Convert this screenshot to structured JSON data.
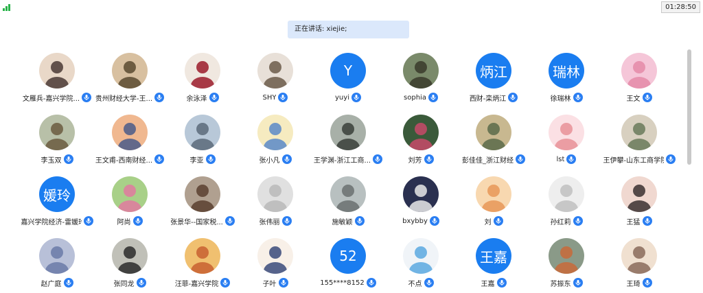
{
  "status": {
    "timer": "01:28:50"
  },
  "speaking": {
    "text": "正在讲话: xiejie;"
  },
  "colors": {
    "accent": "#1a7df0",
    "mic": "#2a7ef2",
    "banner_bg": "#dbe8fb",
    "signal": "#29b34a"
  },
  "participants": [
    {
      "name": "文雁兵-嘉兴学院...",
      "avatar_text": ""
    },
    {
      "name": "贵州财经大学-王...",
      "avatar_text": ""
    },
    {
      "name": "余泳泽",
      "avatar_text": ""
    },
    {
      "name": "SHY",
      "avatar_text": ""
    },
    {
      "name": "yuyi",
      "avatar_text": "Y"
    },
    {
      "name": "sophia",
      "avatar_text": ""
    },
    {
      "name": "西财-栾炳江",
      "avatar_text": "炳江"
    },
    {
      "name": "徐瑞林",
      "avatar_text": "瑞林"
    },
    {
      "name": "王文",
      "avatar_text": ""
    },
    {
      "name": "李玉双",
      "avatar_text": ""
    },
    {
      "name": "王文甫-西南财经...",
      "avatar_text": ""
    },
    {
      "name": "李亚",
      "avatar_text": ""
    },
    {
      "name": "张小凡",
      "avatar_text": ""
    },
    {
      "name": "王学渊-浙江工商...",
      "avatar_text": ""
    },
    {
      "name": "刘芳",
      "avatar_text": ""
    },
    {
      "name": "彭佳佳_浙江财经",
      "avatar_text": ""
    },
    {
      "name": "lst",
      "avatar_text": ""
    },
    {
      "name": "王伊攀-山东工商学院",
      "avatar_text": ""
    },
    {
      "name": "嘉兴学院经济-雷媛玲",
      "avatar_text": "媛玲"
    },
    {
      "name": "阿尚",
      "avatar_text": ""
    },
    {
      "name": "张景华--国家税...",
      "avatar_text": ""
    },
    {
      "name": "张伟丽",
      "avatar_text": ""
    },
    {
      "name": "施敏颖",
      "avatar_text": ""
    },
    {
      "name": "bxybby",
      "avatar_text": ""
    },
    {
      "name": "刘",
      "avatar_text": ""
    },
    {
      "name": "孙红莉",
      "avatar_text": ""
    },
    {
      "name": "王猛",
      "avatar_text": ""
    },
    {
      "name": "赵广庭",
      "avatar_text": ""
    },
    {
      "name": "张同龙",
      "avatar_text": ""
    },
    {
      "name": "汪菲-嘉兴学院",
      "avatar_text": ""
    },
    {
      "name": "子叶",
      "avatar_text": ""
    },
    {
      "name": "155****8152",
      "avatar_text": "52"
    },
    {
      "name": "不点",
      "avatar_text": ""
    },
    {
      "name": "王嘉",
      "avatar_text": "王嘉"
    },
    {
      "name": "苏振东",
      "avatar_text": ""
    },
    {
      "name": "王琦",
      "avatar_text": ""
    }
  ]
}
